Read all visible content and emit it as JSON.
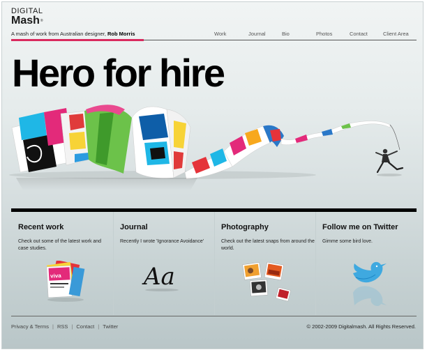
{
  "logo": {
    "line1": "DIGITAL",
    "line2": "Mash",
    "reg": "®"
  },
  "tagline": {
    "text": "A mash of work from Australian designer, ",
    "name": "Rob Morris"
  },
  "nav": [
    "Work",
    "Journal",
    "Bio",
    "Photos",
    "Contact",
    "Client Area"
  ],
  "hero": {
    "title": "Hero for hire"
  },
  "sections": [
    {
      "title": "Recent work",
      "text": "Check out some of the latest work and case studies.",
      "icon": "magazines-icon",
      "art_text": "viva"
    },
    {
      "title": "Journal",
      "text": "Recently I wrote 'Ignorance Avoidance'",
      "icon": "handwritten-aa-icon",
      "art_text": "Aa"
    },
    {
      "title": "Photography",
      "text": "Check out the latest snaps from around the world.",
      "icon": "photos-icon"
    },
    {
      "title": "Follow me on Twitter",
      "text": "Gimme some bird love.",
      "icon": "twitter-bird-icon"
    }
  ],
  "footer": {
    "links": [
      "Privacy & Terms",
      "RSS",
      "Contact",
      "Twitter"
    ],
    "separator": "|",
    "copyright": "© 2002-2009 Digitalmash. All Rights Reserved."
  },
  "colors": {
    "accent": "#d92a5e",
    "twitter": "#3fa9e0",
    "bar": "#000000"
  }
}
